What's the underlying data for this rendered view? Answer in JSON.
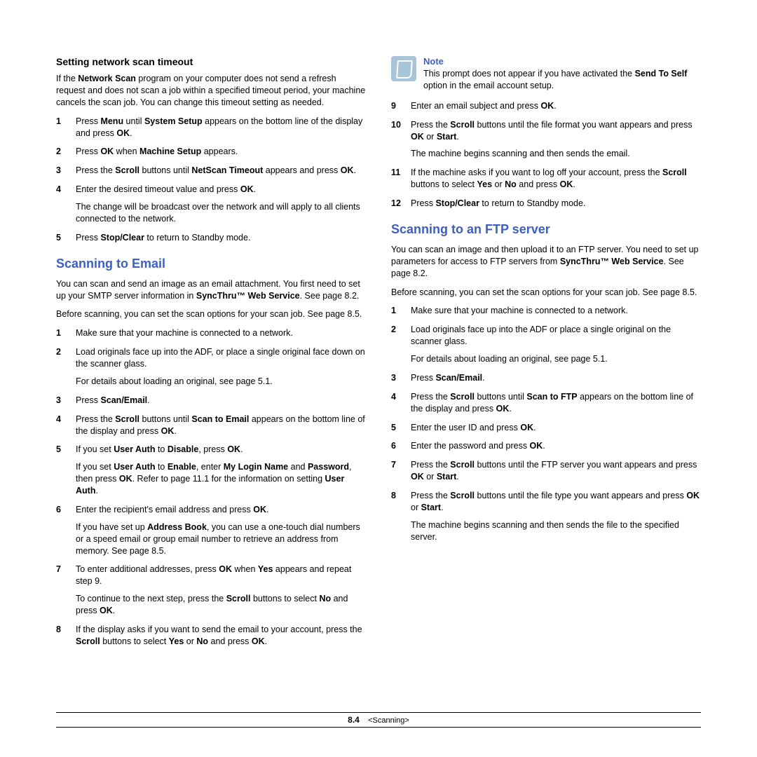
{
  "left": {
    "timeout_heading": "Setting network scan timeout",
    "timeout_intro_parts": [
      "If the ",
      "Network Scan",
      " program on your computer does not send a refresh request and does not scan a job within a specified timeout period, your machine cancels the scan job. You can change this timeout setting as needed."
    ],
    "timeout_steps": [
      {
        "n": "1",
        "parts": [
          "Press ",
          "Menu",
          " until ",
          "System Setup",
          " appears on the bottom line of the display and press ",
          "OK",
          "."
        ]
      },
      {
        "n": "2",
        "parts": [
          "Press ",
          "OK",
          " when ",
          "Machine Setup",
          " appears."
        ]
      },
      {
        "n": "3",
        "parts": [
          "Press the ",
          "Scroll",
          " buttons until ",
          "NetScan Timeout",
          " appears and press ",
          "OK",
          "."
        ]
      },
      {
        "n": "4",
        "parts": [
          "Enter the desired timeout value and press ",
          "OK",
          "."
        ],
        "extra": "The change will be broadcast over the network and will apply to all clients connected to the network."
      },
      {
        "n": "5",
        "parts": [
          "Press ",
          "Stop/Clear",
          " to return to Standby mode."
        ]
      }
    ],
    "email_heading": "Scanning to Email",
    "email_intro_parts": [
      "You can scan and send an image as an email attachment. You first need to set up your SMTP server information in ",
      "SyncThru™ Web Service",
      ". See page 8.2."
    ],
    "email_before": "Before scanning, you can set the scan options for your scan job. See page 8.5.",
    "email_steps": [
      {
        "n": "1",
        "parts": [
          "Make sure that your machine is connected to a network."
        ]
      },
      {
        "n": "2",
        "parts": [
          "Load originals face up into the ADF, or place a single original face down on the scanner glass."
        ],
        "extra": "For details about loading an original, see page 5.1."
      },
      {
        "n": "3",
        "parts": [
          "Press ",
          "Scan/Email",
          "."
        ]
      },
      {
        "n": "4",
        "parts": [
          "Press the ",
          "Scroll",
          " buttons until ",
          "Scan to Email",
          " appears on the bottom line of the display and press ",
          "OK",
          "."
        ]
      },
      {
        "n": "5",
        "parts": [
          "If you set  ",
          "User Auth",
          " to ",
          "Disable",
          ", press ",
          "OK",
          "."
        ],
        "extra_parts": [
          "If you set  ",
          "User Auth",
          " to ",
          "Enable",
          ", enter ",
          "My Login Name",
          " and ",
          "Password",
          ", then press ",
          "OK",
          ". Refer to page 11.1 for the information on setting  ",
          "User Auth",
          "."
        ]
      },
      {
        "n": "6",
        "parts": [
          "Enter the recipient's email address and press ",
          "OK",
          "."
        ],
        "extra_parts": [
          "If you have set up ",
          "Address Book",
          ", you can use a one-touch dial numbers or a speed email or group email number to retrieve an address from memory. See page 8.5."
        ]
      },
      {
        "n": "7",
        "parts": [
          "To enter additional addresses, press ",
          "OK",
          " when ",
          "Yes",
          " appears and repeat step 9."
        ],
        "extra_parts": [
          "To continue to the next step, press the ",
          "Scroll",
          " buttons to select ",
          "No",
          " and press ",
          "OK",
          "."
        ]
      },
      {
        "n": "8",
        "parts": [
          "If the display asks if you want to send the email to your account, press the ",
          "Scroll",
          " buttons to select ",
          "Yes",
          " or ",
          "No",
          " and press ",
          "OK",
          "."
        ]
      }
    ]
  },
  "right": {
    "note_title": "Note",
    "note_parts": [
      "This prompt does not appear if you have activated the ",
      "Send To Self",
      " option in the email account setup."
    ],
    "cont_steps": [
      {
        "n": "9",
        "parts": [
          "Enter an email subject and press ",
          "OK",
          "."
        ]
      },
      {
        "n": "10",
        "parts": [
          "Press the ",
          "Scroll",
          " buttons until the file format you want appears and press ",
          "OK",
          " or ",
          "Start",
          "."
        ],
        "extra": "The machine begins scanning and then sends the email."
      },
      {
        "n": "11",
        "parts": [
          "If the machine asks if you want to log off your account, press the ",
          "Scroll",
          " buttons to select ",
          "Yes",
          " or ",
          "No",
          " and press ",
          "OK",
          "."
        ]
      },
      {
        "n": "12",
        "parts": [
          "Press ",
          "Stop/Clear",
          " to return to Standby mode."
        ]
      }
    ],
    "ftp_heading": "Scanning to an FTP server",
    "ftp_intro_parts": [
      "You can scan an image and then upload it to an FTP server. You need to set up parameters for access to FTP servers from ",
      "SyncThru™ Web Service",
      ". See page 8.2."
    ],
    "ftp_before": "Before scanning, you can set the scan options for your scan job. See page 8.5.",
    "ftp_steps": [
      {
        "n": "1",
        "parts": [
          "Make sure that your machine is connected to a network."
        ]
      },
      {
        "n": "2",
        "parts": [
          "Load originals face up into the ADF or place a single original on the scanner glass."
        ],
        "extra": "For details about loading an original, see page 5.1."
      },
      {
        "n": "3",
        "parts": [
          "Press ",
          "Scan/Email",
          "."
        ]
      },
      {
        "n": "4",
        "parts": [
          "Press the ",
          "Scroll",
          " buttons until ",
          "Scan to FTP",
          " appears on the bottom line of the display and press ",
          "OK",
          "."
        ]
      },
      {
        "n": "5",
        "parts": [
          "Enter the user ID and press ",
          "OK",
          "."
        ]
      },
      {
        "n": "6",
        "parts": [
          "Enter the password and press ",
          "OK",
          "."
        ]
      },
      {
        "n": "7",
        "parts": [
          "Press the ",
          "Scroll",
          " buttons until the FTP server you want appears and press ",
          "OK",
          " or ",
          "Start",
          "."
        ]
      },
      {
        "n": "8",
        "parts": [
          "Press the ",
          "Scroll",
          " buttons until the file type you want appears and press ",
          "OK",
          " or ",
          "Start",
          "."
        ],
        "extra": "The machine begins scanning and then sends the file to the specified server."
      }
    ]
  },
  "footer": {
    "page": "8.4",
    "section": "<Scanning>"
  }
}
